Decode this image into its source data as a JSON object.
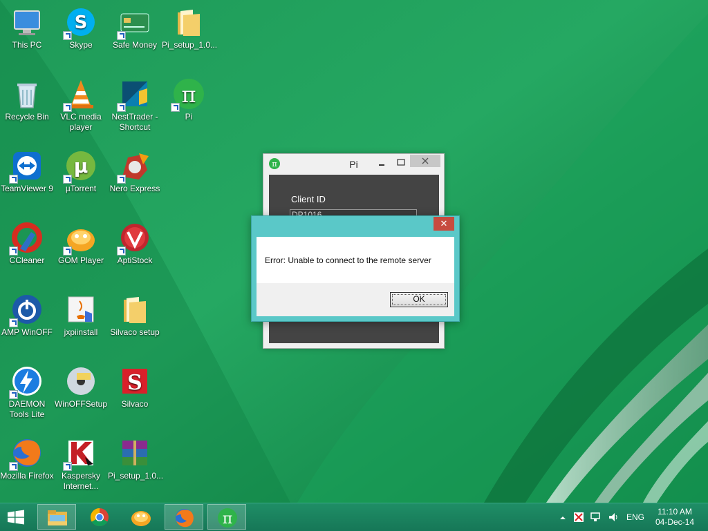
{
  "desktop": {
    "icons": [
      {
        "label": "This PC",
        "icon": "computer-icon"
      },
      {
        "label": "Skype",
        "icon": "skype-icon"
      },
      {
        "label": "Safe Money",
        "icon": "credit-card-icon"
      },
      {
        "label": "Pi_setup_1.0...",
        "icon": "folder-icon"
      },
      {
        "label": "Recycle Bin",
        "icon": "recycle-bin-icon"
      },
      {
        "label": "VLC media player",
        "icon": "vlc-cone-icon"
      },
      {
        "label": "NestTrader - Shortcut",
        "icon": "nesttrader-icon"
      },
      {
        "label": "Pi",
        "icon": "pi-icon"
      },
      {
        "label": "TeamViewer 9",
        "icon": "teamviewer-icon"
      },
      {
        "label": "µTorrent",
        "icon": "utorrent-icon"
      },
      {
        "label": "Nero Express",
        "icon": "nero-icon"
      },
      {
        "label": "CCleaner",
        "icon": "ccleaner-icon"
      },
      {
        "label": "GOM Player",
        "icon": "gom-player-icon"
      },
      {
        "label": "AptiStock",
        "icon": "aptistock-icon"
      },
      {
        "label": "AMP WinOFF",
        "icon": "power-icon"
      },
      {
        "label": "jxpiinstall",
        "icon": "java-installer-icon"
      },
      {
        "label": "Silvaco setup",
        "icon": "folder-icon"
      },
      {
        "label": "DAEMON Tools Lite",
        "icon": "daemon-tools-icon"
      },
      {
        "label": "WinOFFSetup",
        "icon": "setup-disc-icon"
      },
      {
        "label": "Silvaco",
        "icon": "silvaco-icon"
      },
      {
        "label": "Mozilla Firefox",
        "icon": "firefox-icon"
      },
      {
        "label": "Kaspersky Internet...",
        "icon": "kaspersky-icon"
      },
      {
        "label": "Pi_setup_1.0...",
        "icon": "winrar-icon"
      }
    ]
  },
  "pi_window": {
    "title": "Pi",
    "client_id_label": "Client ID",
    "client_id_value": "DP1016"
  },
  "error_dialog": {
    "message": "Error: Unable to connect to the remote server",
    "ok_label": "OK",
    "close_glyph": "✕"
  },
  "taskbar": {
    "apps": [
      "file-explorer-icon",
      "chrome-icon",
      "gom-player-icon",
      "firefox-icon",
      "pi-icon"
    ],
    "language": "ENG",
    "time": "11:10 AM",
    "date": "04-Dec-14"
  }
}
